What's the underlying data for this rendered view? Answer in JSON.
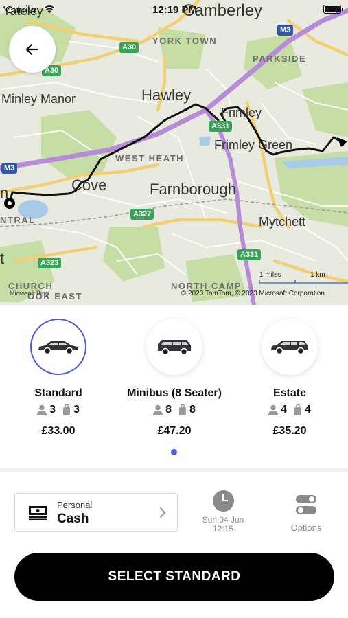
{
  "status_bar": {
    "carrier": "Carrier",
    "time": "12:19 PM"
  },
  "map": {
    "labels": {
      "yateley": "Yateley",
      "camberley": "Camberley",
      "york_town": "YORK TOWN",
      "parkside": "PARKSIDE",
      "minley_manor": "Minley Manor",
      "hawley": "Hawley",
      "frimley": "Frimley",
      "frimley_green": "Frimley Green",
      "west_heath": "WEST HEATH",
      "cove": "Cove",
      "farnborough": "Farnborough",
      "mytchett": "Mytchett",
      "central": "NTRAL",
      "church": "CHURCH",
      "cook_east": "OOK EAST",
      "north_camp": "NORTH CAMP",
      "edge_t": "t",
      "edge_n": "n"
    },
    "roads": {
      "a30_1": "A30",
      "a30_2": "A30",
      "m3_1": "M3",
      "m3_2": "M3",
      "a331_1": "A331",
      "a331_2": "A331",
      "a327": "A327",
      "a323": "A323"
    },
    "scale": {
      "miles": "1 miles",
      "km": "1 km"
    },
    "copyright": "© 2023 TomTom, © 2023 Microsoft Corporation",
    "bing": "Microsoft Bing",
    "colors": {
      "route": "#111111",
      "motorway": "#b48ad6",
      "primary_road": "#f5d27a",
      "park": "#c3dca0"
    }
  },
  "vehicles": {
    "items": [
      {
        "name": "Standard",
        "passengers": "3",
        "luggage": "3",
        "price": "£33.00",
        "icon": "sedan-icon",
        "selected": true
      },
      {
        "name": "Minibus (8 Seater)",
        "passengers": "8",
        "luggage": "8",
        "price": "£47.20",
        "icon": "minibus-icon",
        "selected": false
      },
      {
        "name": "Estate",
        "passengers": "4",
        "luggage": "4",
        "price": "£35.20",
        "icon": "estate-icon",
        "selected": false
      }
    ],
    "page_indicator": {
      "current": 1,
      "total": 1
    },
    "accent_color": "#4f5bd5"
  },
  "payment": {
    "label": "Personal",
    "value": "Cash",
    "icon": "cash-icon"
  },
  "schedule": {
    "date": "Sun 04 Jun",
    "time": "12:15",
    "icon": "clock-icon"
  },
  "options": {
    "label": "Options",
    "icon": "toggles-icon"
  },
  "select_button": {
    "label": "SELECT STANDARD"
  }
}
